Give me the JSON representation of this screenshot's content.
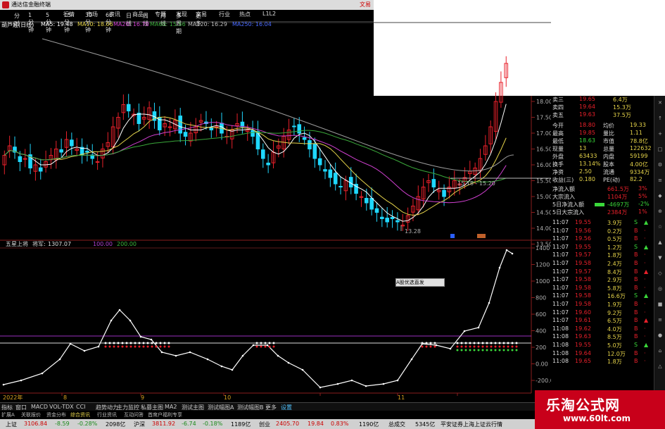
{
  "window": {
    "title": "通达信金融终端",
    "right_text": "文易"
  },
  "menu": {
    "items": [
      "分时",
      "1分钟",
      "5分钟",
      "15分钟",
      "30分钟",
      "60分钟",
      "日线",
      "周线",
      "月线",
      "多周期",
      "更多"
    ],
    "top": [
      "行情",
      "市场",
      "资讯",
      "商品",
      "专题",
      "发现",
      "文易",
      "行业",
      "热点",
      "L1L2"
    ]
  },
  "ma_bar": {
    "stock": "葫芦娃(日线)",
    "ma5": "MA5: 19.48",
    "ma10": "MA10: 18.06",
    "ma20": "MA20: 16.70",
    "ma60": "MA60: 15.56",
    "ma120": "MA120: 16.29",
    "ma250": "MA250: 16.04"
  },
  "price_axis": [
    "18.00",
    "17.50",
    "17.00",
    "16.50",
    "16.00",
    "15.50",
    "15.00",
    "14.50",
    "14.00",
    "13.50"
  ],
  "annotations": {
    "low": "13.28",
    "range": "15.18 - 15.20"
  },
  "indicator": {
    "name": "五星上将",
    "label": "将军:",
    "value": "1307.07",
    "lv1": "100.00",
    "lv2": "200.00",
    "popup": "A股优选直发"
  },
  "ind_axis": [
    "1400",
    "1200",
    "1000",
    "800",
    "600",
    "400",
    "200",
    "0.00",
    "-200.0"
  ],
  "date_axis": [
    "2022年",
    "8",
    "9",
    "10",
    "11"
  ],
  "quote": {
    "top": [
      {
        "l": "卖三",
        "p": "19.65",
        "v": "6.4万"
      },
      {
        "l": "卖四",
        "p": "19.64",
        "v": "15.3万"
      },
      {
        "l": "卖五",
        "p": "19.63",
        "v": "37.5万"
      }
    ],
    "stats": [
      {
        "a": "今开",
        "b": "18.80",
        "c": "均价",
        "d": "19.33"
      },
      {
        "a": "最高",
        "b": "19.85",
        "c": "量比",
        "d": "1.11"
      },
      {
        "a": "最低",
        "b": "18.63",
        "c": "市值",
        "d": "78.8亿"
      },
      {
        "a": "现量",
        "b": "13",
        "c": "总量",
        "d": "122632"
      },
      {
        "a": "外盘",
        "b": "63433",
        "c": "内盘",
        "d": "59199"
      },
      {
        "a": "换手",
        "b": "13.14%",
        "c": "股本",
        "d": "4.00亿"
      },
      {
        "a": "净资",
        "b": "2.50",
        "c": "流通",
        "d": "9334万"
      },
      {
        "a": "收益(三)",
        "b": "0.180",
        "c": "PE(动)",
        "d": "82.2"
      }
    ],
    "flows": [
      {
        "a": "净流入额",
        "b": "661.5万",
        "c": "3%"
      },
      {
        "a": "大宗流入",
        "b": "1104万",
        "c": "5%"
      },
      {
        "a": "5日净流入额",
        "b": "-4697万",
        "c": "-2%"
      },
      {
        "a": "5日大宗流入",
        "b": "2384万",
        "c": "1%"
      }
    ],
    "ticks": [
      {
        "t": "11:07",
        "p": "19.55",
        "v": "3.9万",
        "s": "S"
      },
      {
        "t": "11:07",
        "p": "19.56",
        "v": "0.2万",
        "s": "B"
      },
      {
        "t": "11:07",
        "p": "19.56",
        "v": "0.5万",
        "s": "B"
      },
      {
        "t": "11:07",
        "p": "19.55",
        "v": "1.2万",
        "s": "S"
      },
      {
        "t": "11:07",
        "p": "19.57",
        "v": "1.8万",
        "s": "B"
      },
      {
        "t": "11:07",
        "p": "19.58",
        "v": "2.4万",
        "s": "B"
      },
      {
        "t": "11:07",
        "p": "19.57",
        "v": "8.4万",
        "s": "B"
      },
      {
        "t": "11:07",
        "p": "19.58",
        "v": "2.9万",
        "s": "B"
      },
      {
        "t": "11:07",
        "p": "19.58",
        "v": "5.8万",
        "s": "B"
      },
      {
        "t": "11:07",
        "p": "19.58",
        "v": "16.6万",
        "s": "S"
      },
      {
        "t": "11:07",
        "p": "19.58",
        "v": "1.9万",
        "s": "B"
      },
      {
        "t": "11:07",
        "p": "19.60",
        "v": "9.2万",
        "s": "B"
      },
      {
        "t": "11:07",
        "p": "19.61",
        "v": "6.5万",
        "s": "B"
      },
      {
        "t": "11:08",
        "p": "19.62",
        "v": "4.0万",
        "s": "B"
      },
      {
        "t": "11:08",
        "p": "19.63",
        "v": "8.5万",
        "s": "B"
      },
      {
        "t": "11:08",
        "p": "19.55",
        "v": "5.0万",
        "s": "S"
      },
      {
        "t": "11:08",
        "p": "19.64",
        "v": "12.0万",
        "s": "B"
      },
      {
        "t": "11:08",
        "p": "19.65",
        "v": "1.8万",
        "s": "B"
      }
    ]
  },
  "tabs": [
    "指标",
    "窗口",
    "MACD",
    "VOL-TDX",
    "CCI",
    "趋势动力",
    "主力监控",
    "私募主图",
    "MA2",
    "测试主图",
    "测试幅图A",
    "测试幅图B",
    "更多",
    "设置"
  ],
  "subtabs": [
    "扩展A",
    "关联报价",
    "资金分布",
    "综合资讯",
    "行业资讯",
    "互动问答",
    "首席户福利专享"
  ],
  "status": {
    "sh_label": "上证",
    "sh": "3106.84",
    "sh_chg": "-8.59",
    "sh_pct": "-0.28%",
    "sh_amt": "2098亿",
    "hs_label": "沪深",
    "hs": "3811.92",
    "hs_chg": "-6.74",
    "hs_pct": "-0.18%",
    "hs_amt": "1189亿",
    "cy_label": "创业",
    "cy": "2405.70",
    "cy_chg": "19.84",
    "cy_pct": "0.83%",
    "cy_amt": "1190亿",
    "tot_label": "总成交",
    "tot": "5345亿",
    "broker": "平安证券上海上证云行情"
  },
  "watermark": {
    "cn": "乐淘公式网",
    "url": "www.60lt.com"
  },
  "colors": {
    "up": "#e8202a",
    "down": "#1fd8ff",
    "ma5": "#ffffff",
    "ma10": "#e6d44a",
    "ma20": "#d040d0",
    "ma60": "#3aa83a",
    "ma120": "#9a9a9a"
  }
}
